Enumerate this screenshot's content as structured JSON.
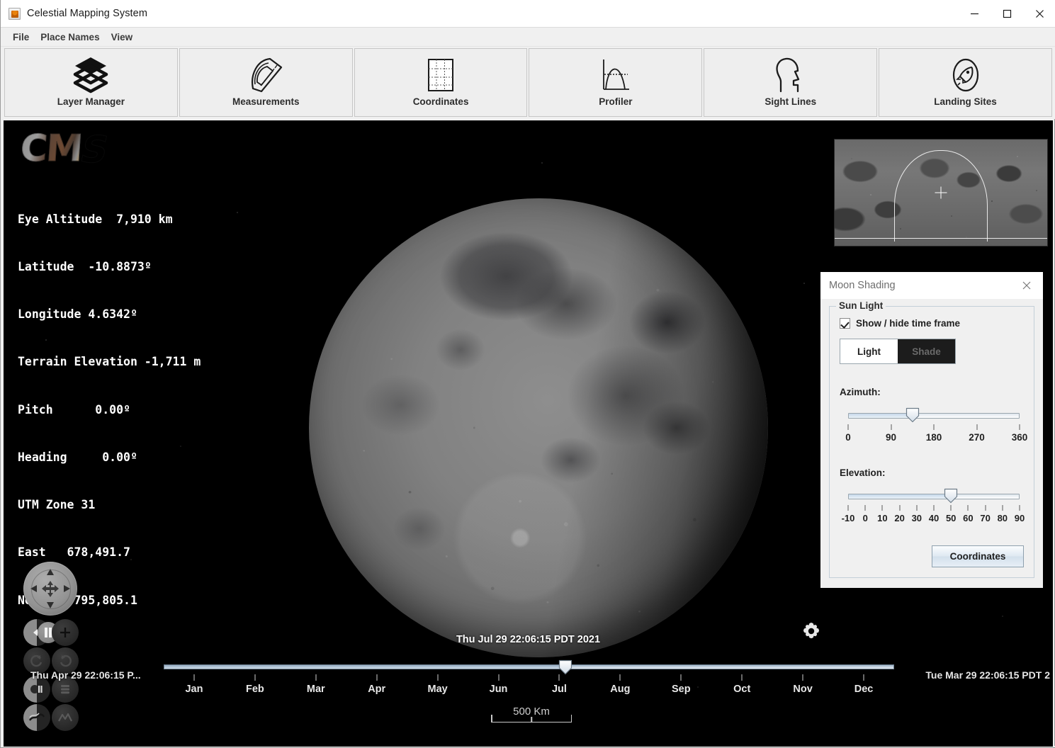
{
  "window": {
    "title": "Celestial Mapping System",
    "icon": "java-coffee-cup-icon",
    "minimize": "—",
    "maximize": "☐",
    "close": "✕"
  },
  "menubar": {
    "items": [
      {
        "label": "File"
      },
      {
        "label": "Place Names"
      },
      {
        "label": "View"
      }
    ]
  },
  "toolbar": {
    "buttons": [
      {
        "label": "Layer Manager",
        "icon": "layers-icon"
      },
      {
        "label": "Measurements",
        "icon": "protractor-ruler-icon"
      },
      {
        "label": "Coordinates",
        "icon": "grid-icon"
      },
      {
        "label": "Profiler",
        "icon": "elevation-profile-icon"
      },
      {
        "label": "Sight Lines",
        "icon": "head-profile-icon"
      },
      {
        "label": "Landing Sites",
        "icon": "rocket-circle-icon"
      }
    ]
  },
  "viewport": {
    "logo": {
      "text_c": "C",
      "text_m": "M",
      "text_s": "S"
    },
    "readout_lines": [
      "Eye Altitude  7,910 km",
      "Latitude  -10.8873º",
      "Longitude 4.6342º",
      "Terrain Elevation -1,711 m",
      "Pitch      0.00º",
      "Heading     0.00º",
      "UTM Zone 31",
      "East   678,491.7",
      "North 8,795,805.1"
    ],
    "readout_fields": {
      "eye_altitude_label": "Eye Altitude",
      "eye_altitude_value": "7,910 km",
      "latitude_label": "Latitude",
      "latitude_value": "-10.8873º",
      "longitude_label": "Longitude",
      "longitude_value": "4.6342º",
      "terrain_elevation_label": "Terrain Elevation",
      "terrain_elevation_value": "-1,711 m",
      "pitch_label": "Pitch",
      "pitch_value": "0.00º",
      "heading_label": "Heading",
      "heading_value": "0.00º",
      "utm_zone_label": "UTM Zone",
      "utm_zone_value": "31",
      "east_label": "East",
      "east_value": "678,491.7",
      "north_label": "North",
      "north_value": "8,795,805.1"
    },
    "scalebar": {
      "label": "500 Km"
    },
    "body": "moon"
  },
  "minimap": {
    "name": "global-moon-minimap",
    "marker": "crosshair"
  },
  "dialog": {
    "title": "Moon Shading",
    "close_label": "✕",
    "group_legend": "Sun Light",
    "checkbox": {
      "label": "Show / hide time frame",
      "checked": true
    },
    "segmented": {
      "light": "Light",
      "shade": "Shade",
      "selected": "Light"
    },
    "azimuth": {
      "label": "Azimuth:",
      "value": 135,
      "min": 0,
      "max": 360,
      "ticks": [
        "0",
        "90",
        "180",
        "270",
        "360"
      ]
    },
    "elevation": {
      "label": "Elevation:",
      "value": 50,
      "min": -10,
      "max": 90,
      "ticks": [
        "-10",
        "0",
        "10",
        "20",
        "30",
        "40",
        "50",
        "60",
        "70",
        "80",
        "90"
      ]
    },
    "button": {
      "label": "Coordinates"
    }
  },
  "navigation": {
    "pad": "pan-navigation-pad",
    "controls": [
      {
        "name": "decrease-speed-button",
        "icon": "minus-arrow-icon"
      },
      {
        "name": "pause-button",
        "icon": "pause-icon"
      },
      {
        "name": "increase-speed-button",
        "icon": "plus-icon"
      },
      {
        "name": "redo-rotate-button",
        "icon": "rotate-cw-icon"
      },
      {
        "name": "undo-rotate-button",
        "icon": "rotate-ccw-icon"
      },
      {
        "name": "contrast-button",
        "icon": "contrast-icon"
      },
      {
        "name": "layers-stack-button",
        "icon": "stack-icon"
      },
      {
        "name": "terrain-toggle-button",
        "icon": "terrain-icon"
      },
      {
        "name": "elevation-toggle-button",
        "icon": "mountain-icon"
      }
    ]
  },
  "timeline": {
    "current_time": "Thu Jul 29 22:06:15 PDT 2021",
    "start_label": "Thu Apr 29 22:06:15 P...",
    "end_label": "Tue Mar 29 22:06:15 PDT 2",
    "thumb_percent": 55,
    "months": [
      "Jan",
      "Feb",
      "Mar",
      "Apr",
      "May",
      "Jun",
      "Jul",
      "Aug",
      "Sep",
      "Oct",
      "Nov",
      "Dec"
    ],
    "settings_icon": "gear-icon"
  },
  "colors": {
    "chrome": "#f0f0f0",
    "titlebar": "#ffffff",
    "viewport_bg": "#000000",
    "accent": "#c6d8ea",
    "text": "#1f1f1f"
  }
}
